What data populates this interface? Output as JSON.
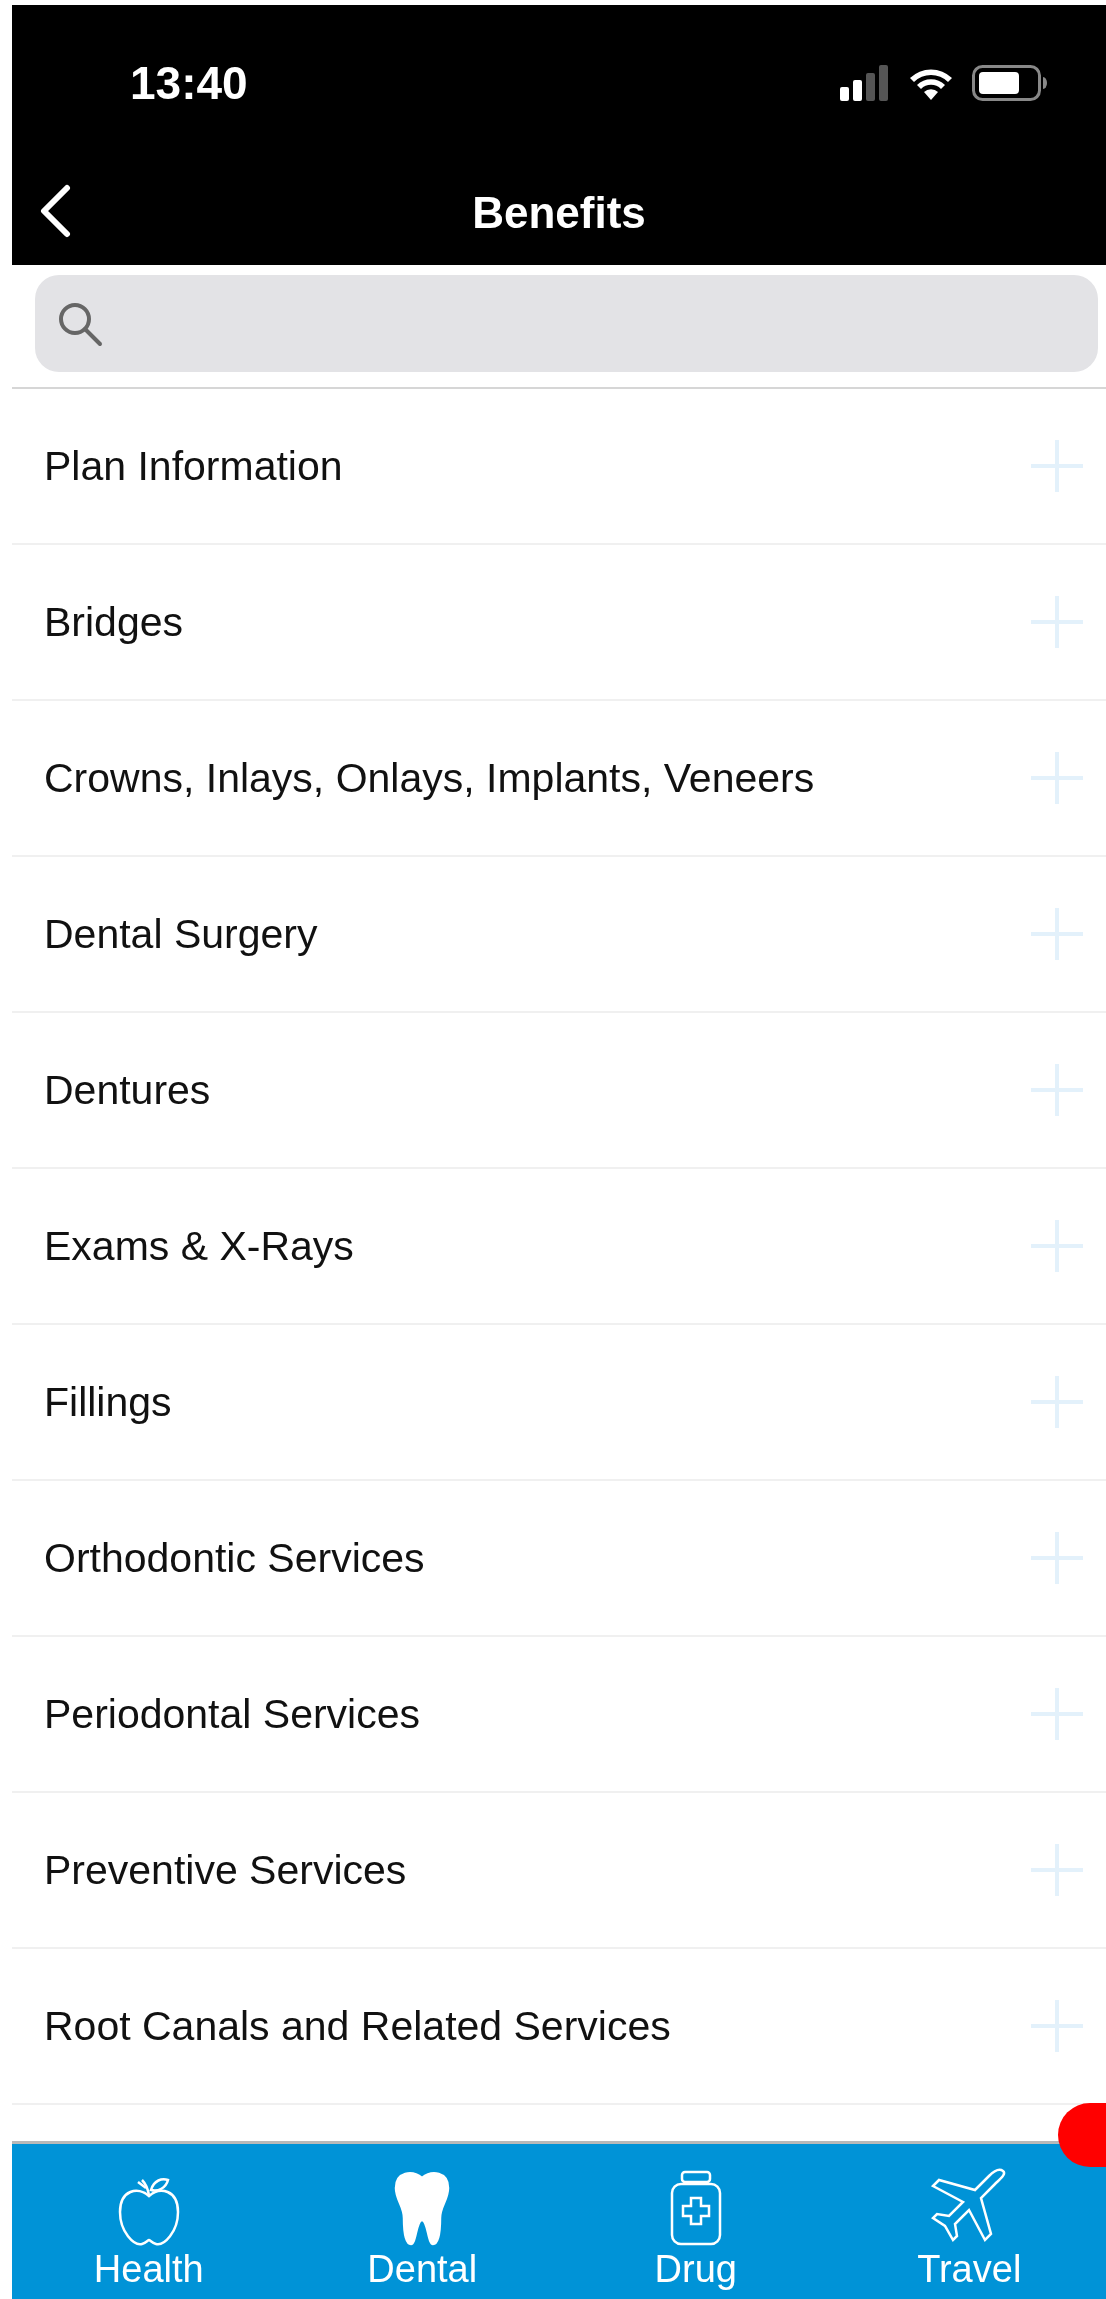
{
  "status_bar": {
    "time": "13:40"
  },
  "nav": {
    "title": "Benefits"
  },
  "items": [
    {
      "label": "Plan Information"
    },
    {
      "label": "Bridges"
    },
    {
      "label": "Crowns, Inlays, Onlays, Implants, Veneers"
    },
    {
      "label": "Dental Surgery"
    },
    {
      "label": "Dentures"
    },
    {
      "label": "Exams & X-Rays"
    },
    {
      "label": "Fillings"
    },
    {
      "label": "Orthodontic Services"
    },
    {
      "label": "Periodontal Services"
    },
    {
      "label": "Preventive Services"
    },
    {
      "label": "Root Canals and Related Services"
    }
  ],
  "tabs": [
    {
      "label": "Health",
      "kind": "apple",
      "selected": false
    },
    {
      "label": "Dental",
      "kind": "tooth",
      "selected": true
    },
    {
      "label": "Drug",
      "kind": "bottle",
      "selected": false
    },
    {
      "label": "Travel",
      "kind": "plane",
      "selected": false
    }
  ]
}
